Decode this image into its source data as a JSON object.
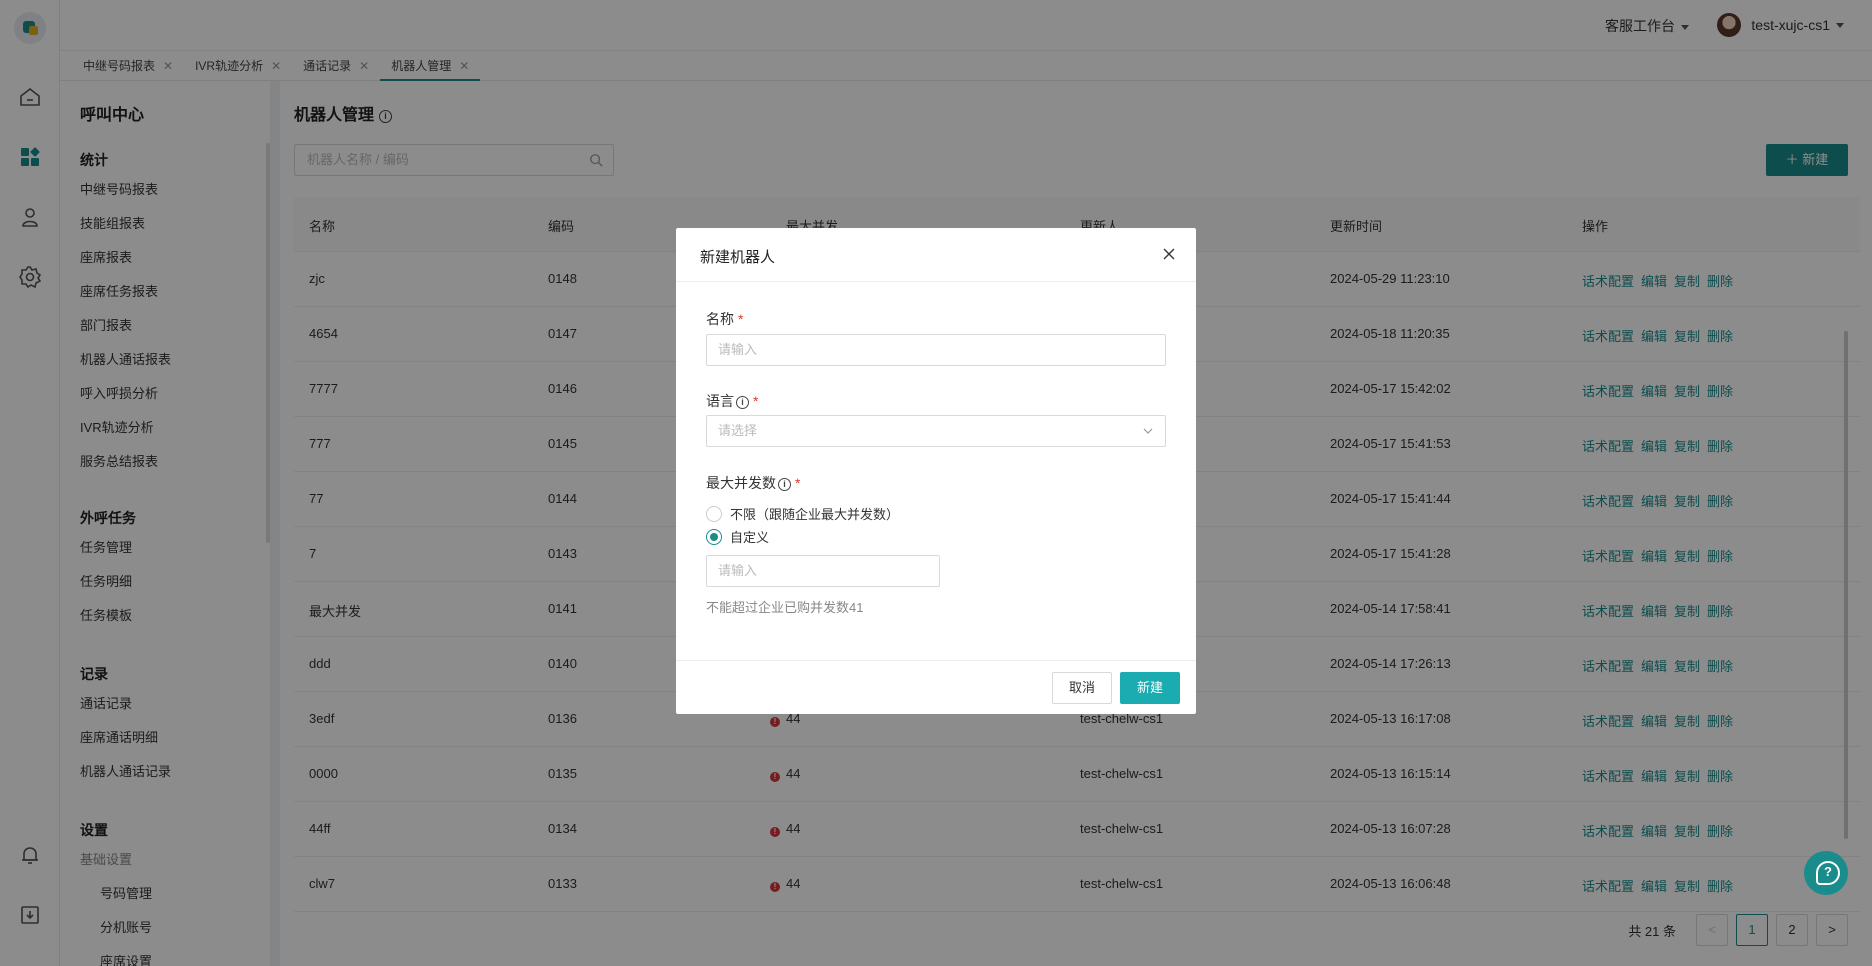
{
  "header": {
    "workbench": "客服工作台",
    "username": "test-xujc-cs1"
  },
  "tabs": [
    {
      "label": "中继号码报表"
    },
    {
      "label": "IVR轨迹分析"
    },
    {
      "label": "通话记录"
    },
    {
      "label": "机器人管理"
    }
  ],
  "menu": {
    "title": "呼叫中心",
    "groups": [
      {
        "title": "统计",
        "items": [
          "中继号码报表",
          "技能组报表",
          "座席报表",
          "座席任务报表",
          "部门报表",
          "机器人通话报表",
          "呼入呼损分析",
          "IVR轨迹分析",
          "服务总结报表"
        ]
      },
      {
        "title": "外呼任务",
        "items": [
          "任务管理",
          "任务明细",
          "任务模板"
        ]
      },
      {
        "title": "记录",
        "items": [
          "通话记录",
          "座席通话明细",
          "机器人通话记录"
        ]
      },
      {
        "title": "设置",
        "items": [
          "基础设置",
          "号码管理",
          "分机账号",
          "座席设置"
        ]
      }
    ]
  },
  "page": {
    "title": "机器人管理",
    "search_placeholder": "机器人名称 / 编码",
    "new_button": "新建"
  },
  "table": {
    "headers": [
      "名称",
      "编码",
      "最大并发",
      "更新人",
      "更新时间",
      "操作"
    ],
    "rows": [
      {
        "name": "zjc",
        "code": "0148",
        "max": "",
        "updater": "",
        "time": "2024-05-29 11:23:10"
      },
      {
        "name": "4654",
        "code": "0147",
        "max": "",
        "updater": "",
        "time": "2024-05-18 11:20:35"
      },
      {
        "name": "7777",
        "code": "0146",
        "max": "",
        "updater": "",
        "time": "2024-05-17 15:42:02"
      },
      {
        "name": "777",
        "code": "0145",
        "max": "",
        "updater": "",
        "time": "2024-05-17 15:41:53"
      },
      {
        "name": "77",
        "code": "0144",
        "max": "",
        "updater": "",
        "time": "2024-05-17 15:41:44"
      },
      {
        "name": "7",
        "code": "0143",
        "max": "",
        "updater": "",
        "time": "2024-05-17 15:41:28"
      },
      {
        "name": "最大并发",
        "code": "0141",
        "max": "",
        "updater": "",
        "time": "2024-05-14 17:58:41"
      },
      {
        "name": "ddd",
        "code": "0140",
        "max": "",
        "updater": "",
        "time": "2024-05-14 17:26:13"
      },
      {
        "name": "3edf",
        "code": "0136",
        "max": "44",
        "updater": "test-chelw-cs1",
        "time": "2024-05-13 16:17:08"
      },
      {
        "name": "0000",
        "code": "0135",
        "max": "44",
        "updater": "test-chelw-cs1",
        "time": "2024-05-13 16:15:14"
      },
      {
        "name": "44ff",
        "code": "0134",
        "max": "44",
        "updater": "test-chelw-cs1",
        "time": "2024-05-13 16:07:28"
      },
      {
        "name": "clw7",
        "code": "0133",
        "max": "44",
        "updater": "test-chelw-cs1",
        "time": "2024-05-13 16:06:48"
      }
    ],
    "actions": [
      "话术配置",
      "编辑",
      "复制",
      "删除"
    ]
  },
  "pager": {
    "total": "共 21 条",
    "pages": [
      "1",
      "2"
    ],
    "current": "1"
  },
  "modal": {
    "title": "新建机器人",
    "name_label": "名称",
    "name_placeholder": "请输入",
    "lang_label": "语言",
    "lang_placeholder": "请选择",
    "concurrency_label": "最大并发数",
    "option_unlimited": "不限（跟随企业最大并发数）",
    "option_custom": "自定义",
    "selected_option": "自定义",
    "custom_placeholder": "请输入",
    "hint": "不能超过企业已购并发数41",
    "cancel": "取消",
    "create": "新建"
  },
  "colors": {
    "accent": "#1a8c8c",
    "create_button": "#1aacb0",
    "required": "#e0392b",
    "warning_dot": "#d9363e"
  },
  "icons": [
    "logo",
    "home-icon",
    "dashboard-icon",
    "user-icon",
    "settings-icon",
    "bell-icon",
    "download-icon",
    "search-icon",
    "plus-icon",
    "close-icon",
    "chevron-down-icon",
    "info-icon",
    "help-chat-icon"
  ]
}
